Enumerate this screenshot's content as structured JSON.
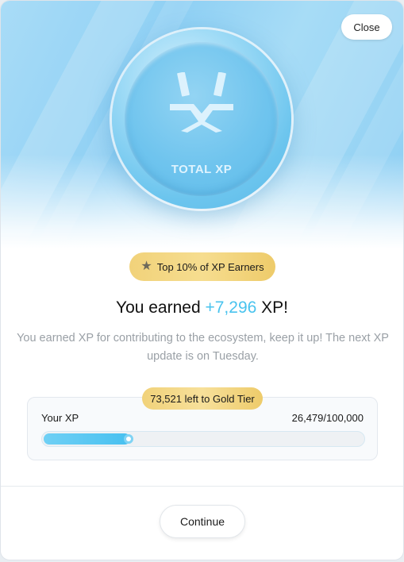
{
  "header": {
    "close_label": "Close"
  },
  "coin": {
    "label": "TOTAL XP",
    "icon": "xp-logo-icon"
  },
  "badge": {
    "icon": "star-icon",
    "text": "Top 10% of XP Earners"
  },
  "headline": {
    "prefix": "You earned ",
    "amount": "+7,296",
    "suffix": " XP!"
  },
  "subtext": "You earned XP for contributing to the ecosystem, keep it up! The next XP update is on Tuesday.",
  "progress": {
    "tier_note": "73,521 left to Gold Tier",
    "label": "Your XP",
    "value_text": "26,479/100,000",
    "current": 26479,
    "max": 100000
  },
  "footer": {
    "continue_label": "Continue"
  },
  "colors": {
    "accent": "#49c3ee",
    "gold": "#f1d27a"
  }
}
